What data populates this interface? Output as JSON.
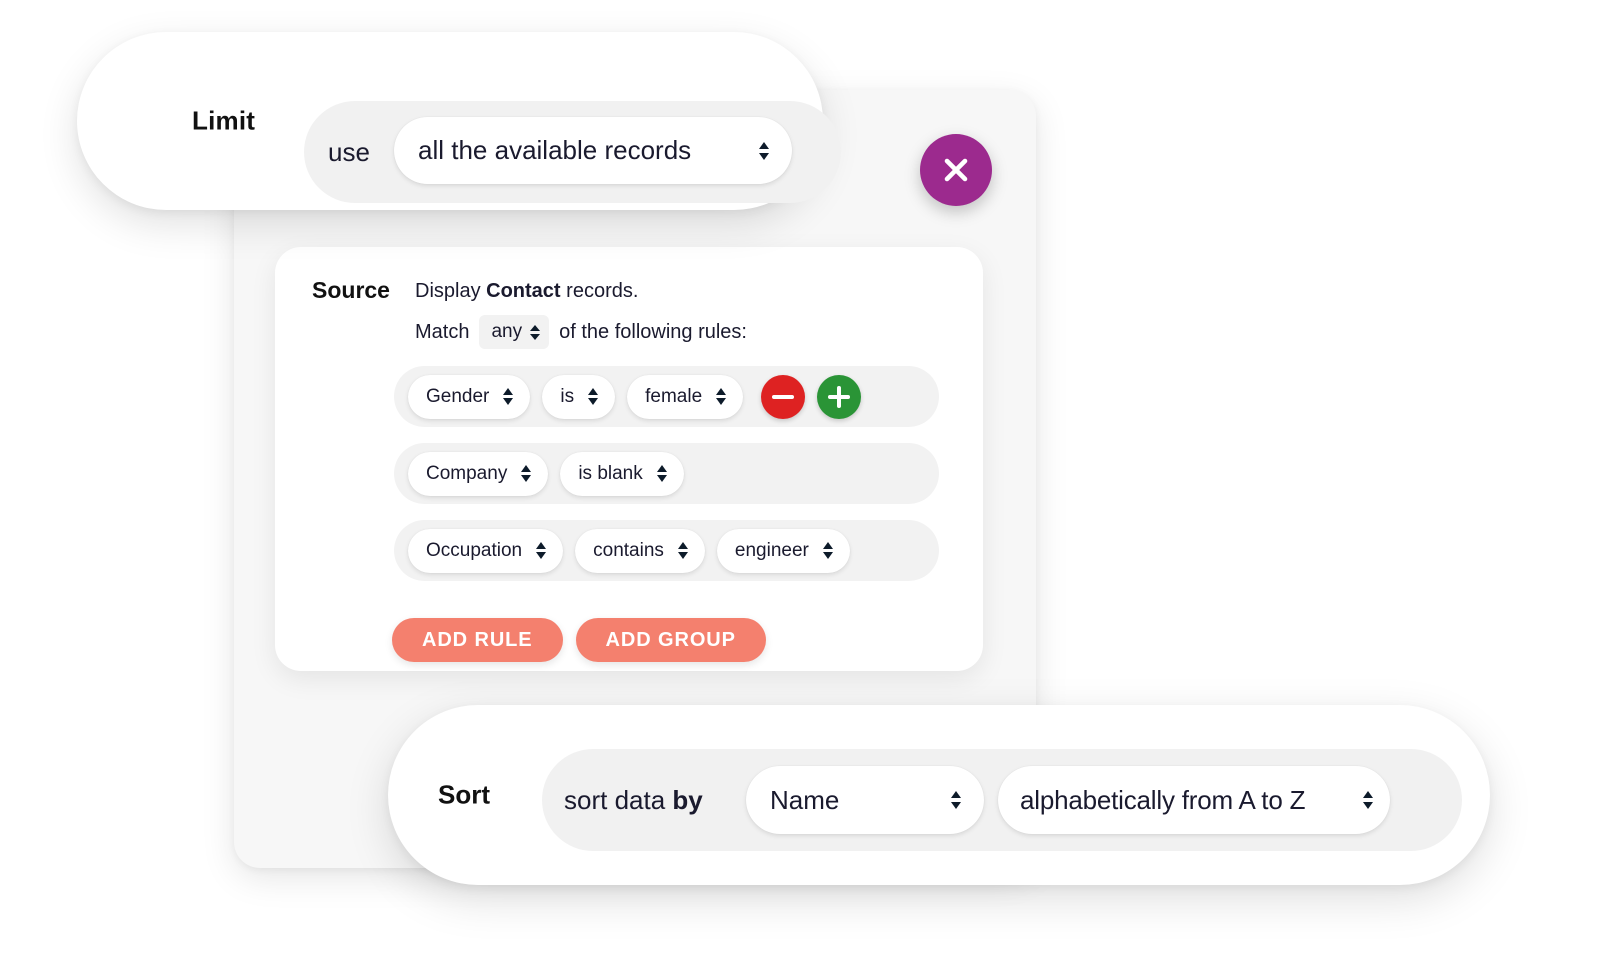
{
  "limit": {
    "title": "Limit",
    "prefix": "use",
    "value": "all the available records",
    "stepper_icon": "up-down-arrows-icon"
  },
  "close_button": {
    "icon": "close-icon",
    "color": "#9c2a8e"
  },
  "source": {
    "title": "Source",
    "display_prefix": "Display",
    "display_entity": "Contact",
    "display_suffix": "records.",
    "match_prefix": "Match",
    "match_value": "any",
    "match_suffix": "of the following rules:",
    "rules": [
      {
        "field": "Gender",
        "operator": "is",
        "value": "female",
        "has_value": true,
        "has_actions": true,
        "remove_icon": "minus-circle-icon",
        "add_icon": "plus-circle-icon"
      },
      {
        "field": "Company",
        "operator": "is blank",
        "value": "",
        "has_value": false,
        "has_actions": false
      },
      {
        "field": "Occupation",
        "operator": "contains",
        "value": "engineer",
        "has_value": true,
        "has_actions": false
      }
    ],
    "add_rule_label": "ADD RULE",
    "add_group_label": "ADD GROUP",
    "accent_color": "#f4806e"
  },
  "sort": {
    "title": "Sort",
    "prefix": "sort data",
    "prefix_bold": "by",
    "field": "Name",
    "direction": "alphabetically from A to Z"
  }
}
